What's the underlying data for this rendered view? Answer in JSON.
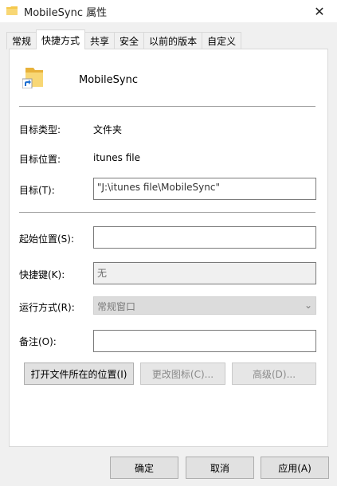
{
  "window": {
    "title": "MobileSync 属性"
  },
  "tabs": [
    {
      "label": "常规"
    },
    {
      "label": "快捷方式"
    },
    {
      "label": "共享"
    },
    {
      "label": "安全"
    },
    {
      "label": "以前的版本"
    },
    {
      "label": "自定义"
    }
  ],
  "active_tab": "快捷方式",
  "header": {
    "name": "MobileSync"
  },
  "info": {
    "target_type_label": "目标类型:",
    "target_type_value": "文件夹",
    "target_location_label": "目标位置:",
    "target_location_value": "itunes file",
    "target_label": "目标(T):",
    "target_value": "\"J:\\itunes file\\MobileSync\""
  },
  "settings": {
    "start_in_label": "起始位置(S):",
    "start_in_value": "",
    "shortcut_key_label": "快捷键(K):",
    "shortcut_key_value": "无",
    "run_label": "运行方式(R):",
    "run_value": "常规窗口",
    "comment_label": "备注(O):",
    "comment_value": ""
  },
  "actions": {
    "open_location": "打开文件所在的位置(I)",
    "change_icon": "更改图标(C)...",
    "advanced": "高级(D)..."
  },
  "footer": {
    "ok": "确定",
    "cancel": "取消",
    "apply": "应用(A)"
  },
  "colors": {
    "folder": "#f5c84c",
    "shortcut_arrow": "#1e6fd0"
  }
}
